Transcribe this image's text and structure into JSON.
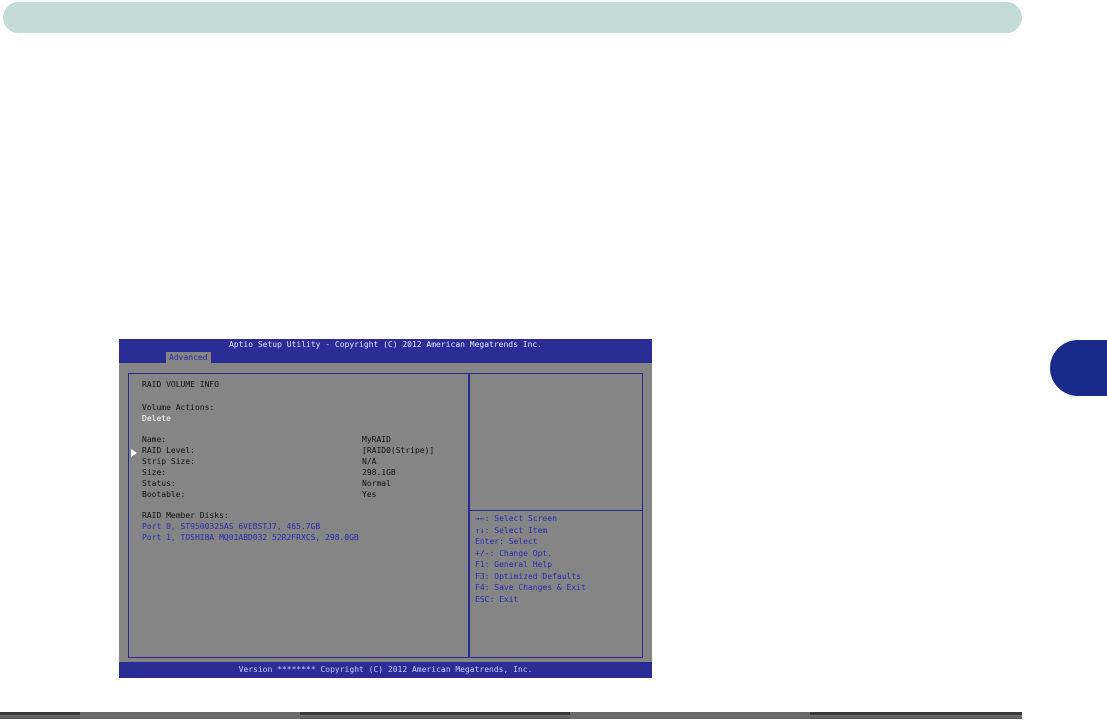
{
  "bios": {
    "title": "Aptio Setup Utility - Copyright (C) 2012 American Megatrends Inc.",
    "tab": "Advanced",
    "footer": "Version ******** Copyright (C) 2012 American Megatrends, Inc.",
    "heading": "RAID VOLUME INFO",
    "volume_actions_label": "Volume Actions:",
    "delete_label": "Delete",
    "fields": [
      {
        "label": "Name:",
        "value": "MyRAID"
      },
      {
        "label": "RAID Level:",
        "value": "[RAID0(Stripe)]"
      },
      {
        "label": "Strip Size:",
        "value": "N/A"
      },
      {
        "label": "Size:",
        "value": "298.1GB"
      },
      {
        "label": "Status:",
        "value": "Normal"
      },
      {
        "label": "Bootable:",
        "value": "Yes"
      }
    ],
    "member_disks_label": "RAID Member Disks:",
    "member_disks": [
      "Port 0, ST9500325AS 6VEBSTJ7, 465.7GB",
      "Port 1, TOSHIBA MQ01ABD032 52R2FRXCS, 298.0GB"
    ],
    "help": [
      "→←: Select Screen",
      "↑↓: Select Item",
      "Enter: Select",
      "+/-: Change Opt.",
      "F1: General Help",
      "F3: Optimized Defaults",
      "F4: Save Changes & Exit",
      "ESC: Exit"
    ]
  },
  "colors": {
    "top_bar": "#c4dbd8",
    "chapter_tab": "#1a2a8a",
    "bios_blue": "#2c2c96",
    "bios_gray": "#858585"
  }
}
